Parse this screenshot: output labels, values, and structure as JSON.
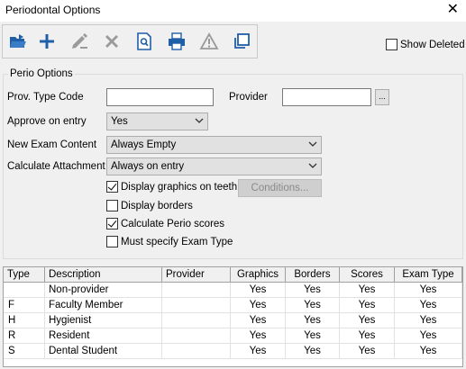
{
  "window": {
    "title": "Periodontal Options",
    "close_glyph": "✕"
  },
  "toolbar": {
    "buttons": [
      {
        "icon": "open-folder-icon",
        "enabled": true
      },
      {
        "icon": "add-icon",
        "enabled": true
      },
      {
        "icon": "edit-pencil-icon",
        "enabled": false
      },
      {
        "icon": "delete-x-icon",
        "enabled": false
      },
      {
        "icon": "search-document-icon",
        "enabled": true
      },
      {
        "icon": "printer-icon",
        "enabled": true
      },
      {
        "icon": "warning-icon",
        "enabled": false
      },
      {
        "icon": "copy-icon",
        "enabled": true
      }
    ],
    "show_deleted_label": "Show Deleted",
    "show_deleted_checked": false
  },
  "perio_options": {
    "group_label": "Perio Options",
    "prov_type_code_label": "Prov. Type Code",
    "prov_type_code_value": "",
    "provider_label": "Provider",
    "provider_value": "",
    "provider_browse_label": "...",
    "approve_label": "Approve on entry",
    "approve_value": "Yes",
    "new_exam_label": "New Exam Content",
    "new_exam_value": "Always Empty",
    "calc_attach_label": "Calculate Attachment",
    "calc_attach_value": "Always on entry",
    "conditions_label": "Conditions...",
    "checkboxes": [
      {
        "label": "Display graphics on teeth",
        "checked": true
      },
      {
        "label": "Display borders",
        "checked": false
      },
      {
        "label": "Calculate Perio scores",
        "checked": true
      },
      {
        "label": "Must specify Exam Type",
        "checked": false
      }
    ]
  },
  "grid": {
    "columns": [
      "Type",
      "Description",
      "Provider",
      "Graphics",
      "Borders",
      "Scores",
      "Exam Type"
    ],
    "rows": [
      {
        "type": "",
        "description": "Non-provider",
        "provider": "",
        "graphics": "Yes",
        "borders": "Yes",
        "scores": "Yes",
        "exam_type": "Yes"
      },
      {
        "type": "F",
        "description": "Faculty Member",
        "provider": "",
        "graphics": "Yes",
        "borders": "Yes",
        "scores": "Yes",
        "exam_type": "Yes"
      },
      {
        "type": "H",
        "description": "Hygienist",
        "provider": "",
        "graphics": "Yes",
        "borders": "Yes",
        "scores": "Yes",
        "exam_type": "Yes"
      },
      {
        "type": "R",
        "description": "Resident",
        "provider": "",
        "graphics": "Yes",
        "borders": "Yes",
        "scores": "Yes",
        "exam_type": "Yes"
      },
      {
        "type": "S",
        "description": "Dental Student",
        "provider": "",
        "graphics": "Yes",
        "borders": "Yes",
        "scores": "Yes",
        "exam_type": "Yes"
      }
    ]
  },
  "colors": {
    "accent_blue": "#1f5fa8",
    "disabled_gray": "#9a9a9a"
  }
}
